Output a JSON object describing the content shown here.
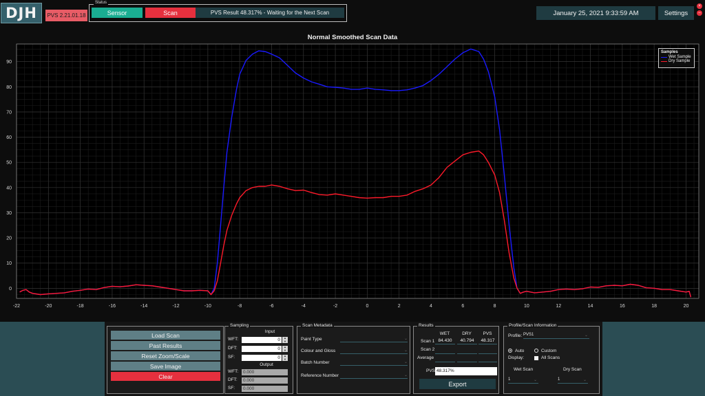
{
  "header": {
    "logo": "DJH",
    "version": "PVS 2.21.01.18",
    "status_legend": "Status",
    "sensor_label": "Sensor",
    "scan_label": "Scan",
    "status_message": "PVS Result 48.317% - Waiting for the Next Scan",
    "datetime": "January 25, 2021 9:33:59 AM",
    "settings_label": "Settings",
    "close_glyph": "×",
    "minimize_glyph": "–"
  },
  "colors": {
    "wet": "#1a1aff",
    "dry": "#ff1a2a",
    "sensor": "#1aae92",
    "scan": "#e6303e",
    "panel": "#1f3b41"
  },
  "chart_data": {
    "type": "line",
    "title": "Normal Smoothed Scan Data",
    "xlabel": "",
    "ylabel": "",
    "xlim": [
      -22,
      20.8
    ],
    "ylim": [
      -4,
      97
    ],
    "xticks": [
      -22,
      -20,
      -18,
      -16,
      -14,
      -12,
      -10,
      -8,
      -6,
      -4,
      -2,
      0,
      2,
      4,
      6,
      8,
      10,
      12,
      14,
      16,
      18,
      20
    ],
    "yticks": [
      0,
      10,
      20,
      30,
      40,
      50,
      60,
      70,
      80,
      90
    ],
    "grid": true,
    "legend_title": "Samples",
    "legend_position": "top-right",
    "series": [
      {
        "name": "Wet Sample",
        "color": "#1a1aff",
        "points": [
          [
            -21.8,
            -1.5
          ],
          [
            -21.6,
            -0.8
          ],
          [
            -21.4,
            -0.5
          ],
          [
            -21.2,
            -1.5
          ],
          [
            -21.0,
            -2.0
          ],
          [
            -20.5,
            -2.5
          ],
          [
            -20.0,
            -2.2
          ],
          [
            -19.5,
            -2.0
          ],
          [
            -19.0,
            -1.8
          ],
          [
            -18.5,
            -1.2
          ],
          [
            -18.0,
            -0.8
          ],
          [
            -17.5,
            -0.3
          ],
          [
            -17.0,
            -0.5
          ],
          [
            -16.5,
            0.3
          ],
          [
            -16.0,
            0.8
          ],
          [
            -15.5,
            0.6
          ],
          [
            -15.0,
            0.9
          ],
          [
            -14.5,
            1.4
          ],
          [
            -14.0,
            1.2
          ],
          [
            -13.5,
            1.0
          ],
          [
            -13.0,
            0.5
          ],
          [
            -12.5,
            0.0
          ],
          [
            -12.0,
            -0.5
          ],
          [
            -11.5,
            -1.0
          ],
          [
            -11.0,
            -1.0
          ],
          [
            -10.5,
            -0.8
          ],
          [
            -10.0,
            -1.0
          ],
          [
            -9.8,
            -2.5
          ],
          [
            -9.6,
            0.0
          ],
          [
            -9.4,
            10.0
          ],
          [
            -9.2,
            25.0
          ],
          [
            -9.0,
            40.0
          ],
          [
            -8.8,
            54.0
          ],
          [
            -8.5,
            68.0
          ],
          [
            -8.2,
            79.0
          ],
          [
            -8.0,
            85.0
          ],
          [
            -7.6,
            90.5
          ],
          [
            -7.2,
            93.0
          ],
          [
            -6.8,
            94.3
          ],
          [
            -6.4,
            94.0
          ],
          [
            -6.0,
            93.0
          ],
          [
            -5.5,
            91.5
          ],
          [
            -5.0,
            88.5
          ],
          [
            -4.5,
            85.5
          ],
          [
            -4.0,
            83.5
          ],
          [
            -3.5,
            82.0
          ],
          [
            -3.0,
            81.0
          ],
          [
            -2.5,
            80.0
          ],
          [
            -2.0,
            79.8
          ],
          [
            -1.5,
            79.5
          ],
          [
            -1.0,
            79.0
          ],
          [
            -0.5,
            79.0
          ],
          [
            0.0,
            79.5
          ],
          [
            0.5,
            79.0
          ],
          [
            1.0,
            78.8
          ],
          [
            1.5,
            78.5
          ],
          [
            2.0,
            78.5
          ],
          [
            2.5,
            78.8
          ],
          [
            3.0,
            79.5
          ],
          [
            3.5,
            80.5
          ],
          [
            4.0,
            82.5
          ],
          [
            4.5,
            85.0
          ],
          [
            5.0,
            88.0
          ],
          [
            5.5,
            91.0
          ],
          [
            6.0,
            93.5
          ],
          [
            6.5,
            95.0
          ],
          [
            7.0,
            94.0
          ],
          [
            7.3,
            91.0
          ],
          [
            7.6,
            86.0
          ],
          [
            8.0,
            76.0
          ],
          [
            8.3,
            63.0
          ],
          [
            8.6,
            45.0
          ],
          [
            8.9,
            25.0
          ],
          [
            9.2,
            8.0
          ],
          [
            9.4,
            0.0
          ],
          [
            9.6,
            -2.0
          ],
          [
            9.8,
            -1.5
          ],
          [
            10.0,
            -1.2
          ],
          [
            10.5,
            -1.8
          ],
          [
            11.0,
            -1.5
          ],
          [
            11.5,
            -1.2
          ],
          [
            12.0,
            -0.5
          ],
          [
            12.5,
            -0.3
          ],
          [
            13.0,
            -0.5
          ],
          [
            13.5,
            -0.2
          ],
          [
            14.0,
            0.5
          ],
          [
            14.5,
            0.4
          ],
          [
            15.0,
            1.0
          ],
          [
            15.5,
            1.2
          ],
          [
            16.0,
            1.0
          ],
          [
            16.5,
            1.6
          ],
          [
            17.0,
            1.2
          ],
          [
            17.5,
            0.2
          ],
          [
            18.0,
            0.0
          ],
          [
            18.5,
            -0.5
          ],
          [
            19.0,
            -0.5
          ],
          [
            19.5,
            -1.0
          ],
          [
            20.0,
            -1.5
          ],
          [
            20.2,
            -1.2
          ],
          [
            20.3,
            -3.5
          ]
        ]
      },
      {
        "name": "Dry Sample",
        "color": "#ff1a2a",
        "points": [
          [
            -21.8,
            -1.5
          ],
          [
            -21.6,
            -0.8
          ],
          [
            -21.4,
            -0.5
          ],
          [
            -21.2,
            -1.5
          ],
          [
            -21.0,
            -2.0
          ],
          [
            -20.5,
            -2.5
          ],
          [
            -20.0,
            -2.2
          ],
          [
            -19.5,
            -2.0
          ],
          [
            -19.0,
            -1.8
          ],
          [
            -18.5,
            -1.2
          ],
          [
            -18.0,
            -0.8
          ],
          [
            -17.5,
            -0.3
          ],
          [
            -17.0,
            -0.5
          ],
          [
            -16.5,
            0.3
          ],
          [
            -16.0,
            0.8
          ],
          [
            -15.5,
            0.6
          ],
          [
            -15.0,
            0.9
          ],
          [
            -14.5,
            1.4
          ],
          [
            -14.0,
            1.2
          ],
          [
            -13.5,
            1.0
          ],
          [
            -13.0,
            0.5
          ],
          [
            -12.5,
            0.0
          ],
          [
            -12.0,
            -0.5
          ],
          [
            -11.5,
            -1.0
          ],
          [
            -11.0,
            -1.0
          ],
          [
            -10.5,
            -0.8
          ],
          [
            -10.0,
            -1.0
          ],
          [
            -9.8,
            -2.5
          ],
          [
            -9.6,
            -1.0
          ],
          [
            -9.4,
            3.0
          ],
          [
            -9.2,
            10.0
          ],
          [
            -9.0,
            17.0
          ],
          [
            -8.8,
            23.0
          ],
          [
            -8.5,
            29.0
          ],
          [
            -8.2,
            33.5
          ],
          [
            -8.0,
            36.0
          ],
          [
            -7.6,
            38.8
          ],
          [
            -7.2,
            40.0
          ],
          [
            -6.8,
            40.5
          ],
          [
            -6.4,
            40.5
          ],
          [
            -6.0,
            41.0
          ],
          [
            -5.5,
            40.5
          ],
          [
            -5.0,
            39.5
          ],
          [
            -4.5,
            38.8
          ],
          [
            -4.0,
            39.0
          ],
          [
            -3.5,
            38.0
          ],
          [
            -3.0,
            37.2
          ],
          [
            -2.5,
            37.0
          ],
          [
            -2.0,
            37.5
          ],
          [
            -1.5,
            37.0
          ],
          [
            -1.0,
            36.5
          ],
          [
            -0.5,
            36.0
          ],
          [
            0.0,
            35.8
          ],
          [
            0.5,
            36.0
          ],
          [
            1.0,
            36.0
          ],
          [
            1.5,
            36.5
          ],
          [
            2.0,
            36.5
          ],
          [
            2.5,
            37.0
          ],
          [
            3.0,
            38.5
          ],
          [
            3.5,
            39.5
          ],
          [
            4.0,
            41.0
          ],
          [
            4.5,
            44.0
          ],
          [
            5.0,
            48.0
          ],
          [
            5.5,
            50.5
          ],
          [
            6.0,
            53.0
          ],
          [
            6.5,
            54.0
          ],
          [
            7.0,
            54.5
          ],
          [
            7.3,
            53.0
          ],
          [
            7.6,
            50.0
          ],
          [
            8.0,
            45.0
          ],
          [
            8.3,
            38.0
          ],
          [
            8.6,
            27.0
          ],
          [
            8.9,
            14.0
          ],
          [
            9.2,
            4.0
          ],
          [
            9.4,
            0.0
          ],
          [
            9.6,
            -2.0
          ],
          [
            9.8,
            -1.5
          ],
          [
            10.0,
            -1.2
          ],
          [
            10.5,
            -1.8
          ],
          [
            11.0,
            -1.5
          ],
          [
            11.5,
            -1.2
          ],
          [
            12.0,
            -0.5
          ],
          [
            12.5,
            -0.3
          ],
          [
            13.0,
            -0.5
          ],
          [
            13.5,
            -0.2
          ],
          [
            14.0,
            0.5
          ],
          [
            14.5,
            0.4
          ],
          [
            15.0,
            1.0
          ],
          [
            15.5,
            1.2
          ],
          [
            16.0,
            1.0
          ],
          [
            16.5,
            1.6
          ],
          [
            17.0,
            1.2
          ],
          [
            17.5,
            0.2
          ],
          [
            18.0,
            0.0
          ],
          [
            18.5,
            -0.5
          ],
          [
            19.0,
            -0.5
          ],
          [
            19.5,
            -1.0
          ],
          [
            20.0,
            -1.5
          ],
          [
            20.2,
            -1.2
          ],
          [
            20.3,
            -3.5
          ]
        ]
      }
    ]
  },
  "actions": {
    "load_scan": "Load Scan",
    "past_results": "Past Results",
    "reset_zoom": "Reset Zoom/Scale",
    "save_image": "Save Image",
    "clear": "Clear"
  },
  "sampling": {
    "legend": "Sampling",
    "input_header": "Input",
    "output_header": "Output",
    "wft_label": "WFT:",
    "dft_label": "DFT:",
    "sf_label": "SF:",
    "wft_in": "0",
    "dft_in": "0",
    "sf_in": "0",
    "wft_out": "0.000",
    "dft_out": "0.000",
    "sf_out": "0.000",
    "spin_up": "▲",
    "spin_down": "▼"
  },
  "metadata": {
    "legend": "Scan Metadata",
    "paint_type": "Paint Type",
    "colour_gloss": "Colour and Gloss",
    "batch_number": "Batch Number",
    "reference_number": "Reference Number",
    "dropdown_glyph": "⌄"
  },
  "results": {
    "legend": "Results",
    "wet_header": "WET",
    "dry_header": "DRY",
    "pvs_header": "PVS",
    "scan1_label": "Scan 1",
    "scan2_label": "Scan 2",
    "average_label": "Average",
    "scan1_wet": "84.430",
    "scan1_dry": "40.794",
    "scan1_pvs": "48.317",
    "pvs_label": "PVS",
    "pvs_value": "48.317%",
    "export_label": "Export"
  },
  "profile": {
    "legend": "Profile/Scan Information",
    "profile_label": "Profile:",
    "profile_value": "PVS1",
    "auto_label": "Auto",
    "custom_label": "Custom",
    "display_label": "Display:",
    "all_scans_label": "All Scans",
    "wet_scan_label": "Wet Scan",
    "dry_scan_label": "Dry Scan",
    "wet_scan_value": "1",
    "dry_scan_value": "1",
    "dropdown_glyph": "⌄"
  }
}
